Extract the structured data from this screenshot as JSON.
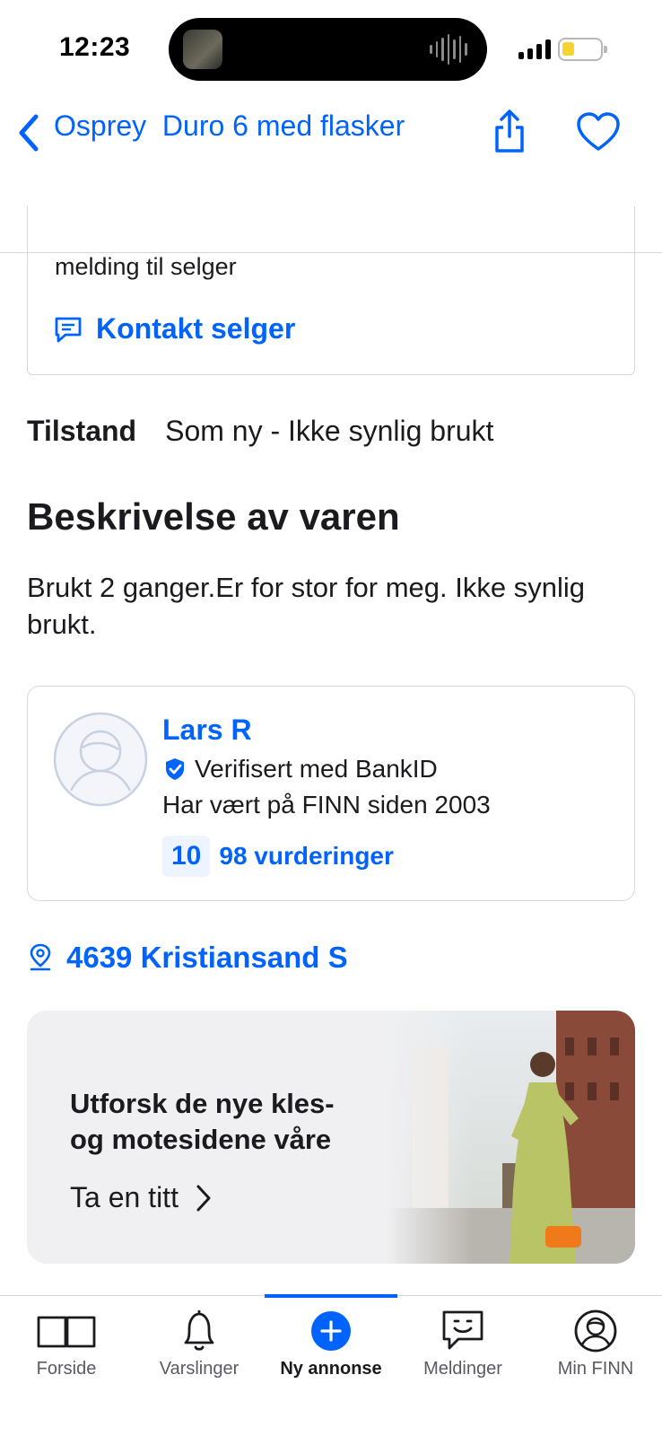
{
  "status": {
    "time": "12:23"
  },
  "nav": {
    "title": "Osprey  Duro 6 med flasker",
    "back_icon": "chevron-left-icon",
    "share_icon": "share-icon",
    "favorite_icon": "heart-icon"
  },
  "contact": {
    "text": "melding til selger",
    "button_label": "Kontakt selger"
  },
  "condition": {
    "label": "Tilstand",
    "value": "Som ny - Ikke synlig brukt"
  },
  "description": {
    "heading": "Beskrivelse av varen",
    "body": "Brukt 2 ganger.Er for stor for meg. Ikke synlig brukt."
  },
  "seller": {
    "name": "Lars R",
    "verified": "Verifisert med BankID",
    "since": "Har vært på FINN siden 2003",
    "score": "10",
    "reviews": "98 vurderinger"
  },
  "location": {
    "text": "4639 Kristiansand S"
  },
  "promo": {
    "line1": "Utforsk de nye kles-",
    "line2": "og motesidene våre",
    "link": "Ta en titt"
  },
  "tabs": [
    {
      "label": "Forside",
      "icon": "book-icon"
    },
    {
      "label": "Varslinger",
      "icon": "bell-icon"
    },
    {
      "label": "Ny annonse",
      "icon": "plus-circle-icon",
      "active": true
    },
    {
      "label": "Meldinger",
      "icon": "chat-smile-icon"
    },
    {
      "label": "Min FINN",
      "icon": "profile-icon"
    }
  ],
  "colors": {
    "accent": "#0063fb",
    "text": "#1b1b1f",
    "border": "#d8d8dc"
  }
}
